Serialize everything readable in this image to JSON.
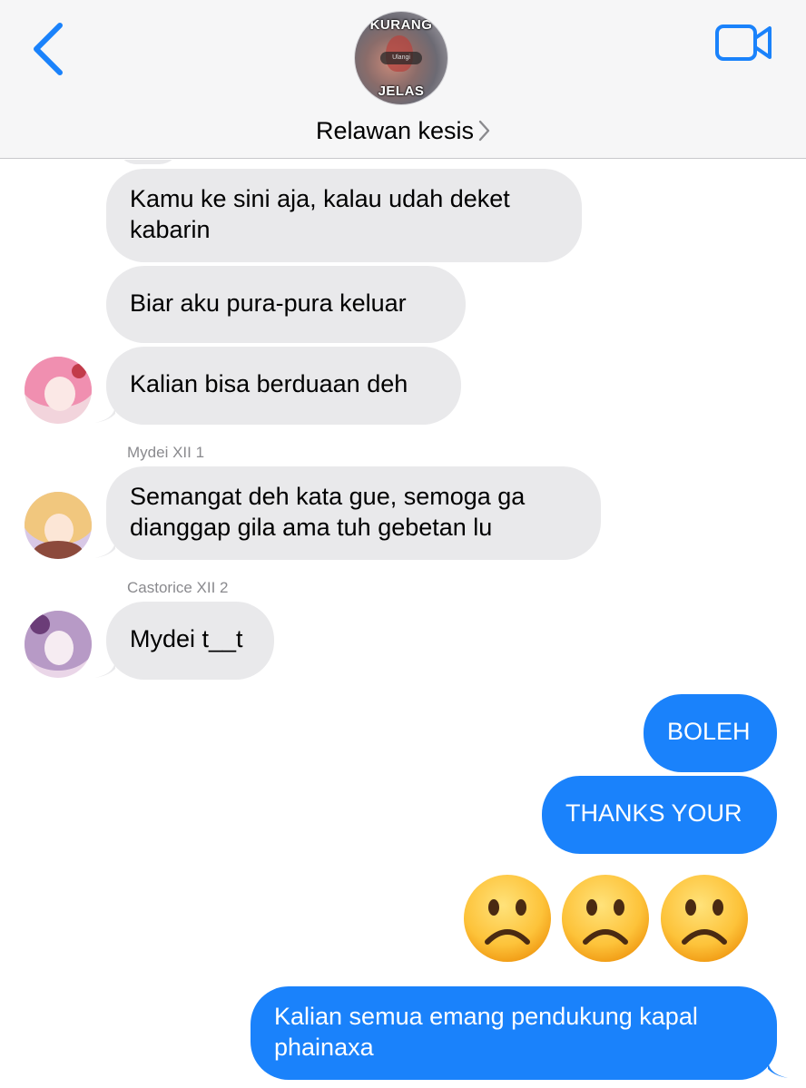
{
  "header": {
    "group_name": "Relawan kesis",
    "avatar_text_top": "KURANG",
    "avatar_text_bottom": "JELAS",
    "avatar_pill_text": "Ulangi"
  },
  "messages": [
    {
      "direction": "in",
      "text_lines": [
        "Kamu ke sini aja, kalau udah deket",
        "kabarin"
      ]
    },
    {
      "direction": "in",
      "text_lines": [
        "Biar aku pura-pura keluar"
      ]
    },
    {
      "direction": "in",
      "text_lines": [
        "Kalian bisa berduaan deh"
      ]
    },
    {
      "direction": "in",
      "sender": "Mydei XII 1",
      "text_lines": [
        "Semangat deh kata gue, semoga ga",
        "dianggap gila ama tuh gebetan lu"
      ]
    },
    {
      "direction": "in",
      "sender": "Castorice XII 2",
      "text_lines": [
        "Mydei t__t"
      ]
    },
    {
      "direction": "out",
      "text_lines": [
        "BOLEH"
      ]
    },
    {
      "direction": "out",
      "text_lines": [
        "THANKS YOUR"
      ]
    },
    {
      "direction": "out",
      "emoji": [
        "frowning-face",
        "frowning-face",
        "frowning-face"
      ]
    },
    {
      "direction": "out",
      "text_lines": [
        "Kalian semua emang pendukung kapal",
        "phainaxa"
      ]
    }
  ],
  "colors": {
    "accent": "#1a82fb",
    "incoming_bubble": "#e9e9eb",
    "header_bg": "#f6f6f7",
    "sender_label": "#8a8a8e"
  },
  "icons": {
    "back": "chevron-left-icon",
    "video": "video-camera-icon",
    "name_chevron": "chevron-right-icon"
  }
}
